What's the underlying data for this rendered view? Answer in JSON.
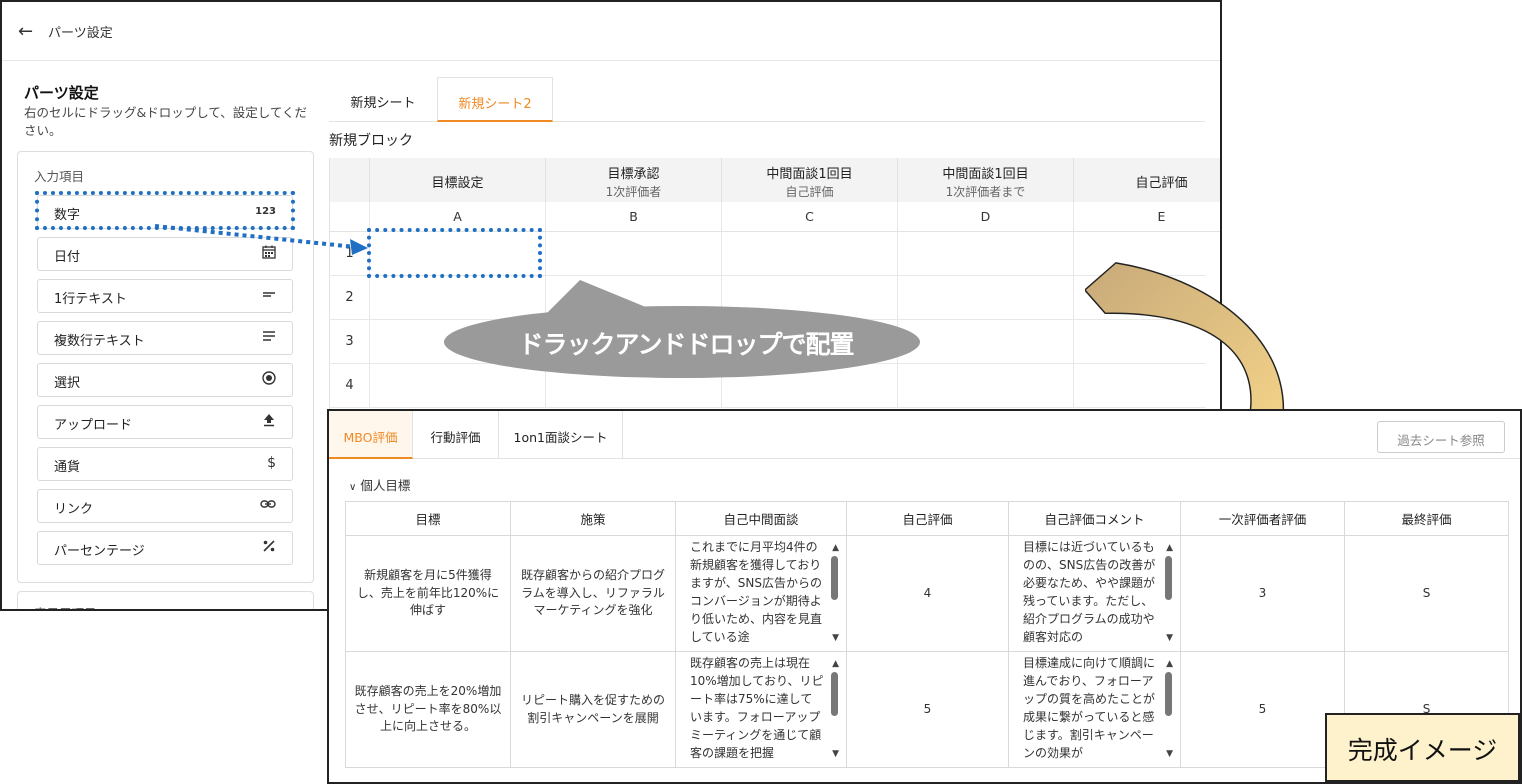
{
  "editor": {
    "topbar_title": "パーツ設定",
    "panel_title": "パーツ設定",
    "panel_desc": "右のセルにドラッグ&ドロップして、設定してください。",
    "parts_section_label": "入力項目",
    "parts_section2_label": "表示用項目",
    "parts": [
      {
        "label": "数字",
        "icon": "123"
      },
      {
        "label": "日付",
        "icon": "calendar-icon"
      },
      {
        "label": "1行テキスト",
        "icon": "short-text-icon"
      },
      {
        "label": "複数行テキスト",
        "icon": "multiline-text-icon"
      },
      {
        "label": "選択",
        "icon": "radio-icon"
      },
      {
        "label": "アップロード",
        "icon": "upload-icon"
      },
      {
        "label": "通貨",
        "icon": "$"
      },
      {
        "label": "リンク",
        "icon": "link-icon"
      },
      {
        "label": "パーセンテージ",
        "icon": "percent-icon"
      }
    ],
    "tabs": [
      "新規シート",
      "新規シート2"
    ],
    "active_tab": "新規シート2",
    "block_title": "新規ブロック",
    "columns": [
      {
        "title": "目標設定",
        "sub": "",
        "letter": "A"
      },
      {
        "title": "目標承認",
        "sub": "1次評価者",
        "letter": "B"
      },
      {
        "title": "中間面談1回目",
        "sub": "自己評価",
        "letter": "C"
      },
      {
        "title": "中間面談1回目",
        "sub": "1次評価者まで",
        "letter": "D"
      },
      {
        "title": "自己評価",
        "sub": "",
        "letter": "E"
      }
    ],
    "row_numbers": [
      "1",
      "2",
      "3",
      "4"
    ],
    "accent": "#f08a24"
  },
  "callout": "ドラックアンドドロップで配置",
  "result": {
    "tabs": [
      "MBO評価",
      "行動評価",
      "1on1面談シート"
    ],
    "active_tab": "MBO評価",
    "past_button": "過去シート参照",
    "section_title": "個人目標",
    "headers": [
      "目標",
      "施策",
      "自己中間面談",
      "自己評価",
      "自己評価コメント",
      "一次評価者評価",
      "最終評価"
    ],
    "rows": [
      {
        "goal": "新規顧客を月に5件獲得し、売上を前年比120%に伸ばす",
        "measure": "既存顧客からの紹介プログラムを導入し、リファラルマーケティングを強化",
        "interview": "これまでに月平均4件の新規顧客を獲得しておりますが、SNS広告からのコンバージョンが期待より低いため、内容を見直している途",
        "self_score": "4",
        "self_comment": "目標には近づいているものの、SNS広告の改善が必要なため、やや課題が残っています。ただし、紹介プログラムの成功や顧客対応の",
        "first_score": "3",
        "final": "S"
      },
      {
        "goal": "既存顧客の売上を20%増加させ、リピート率を80%以上に向上させる。",
        "measure": "リピート購入を促すための割引キャンペーンを展開",
        "interview": "既存顧客の売上は現在10%増加しており、リピート率は75%に達しています。フォローアップミーティングを通じて顧客の課題を把握",
        "self_score": "5",
        "self_comment": "目標達成に向けて順調に進んでおり、フォローアップの質を高めたことが成果に繋がっていると感じます。割引キャンペーンの効果が",
        "first_score": "5",
        "final": "S"
      }
    ]
  },
  "completion_label": "完成イメージ",
  "colors": {
    "highlight_dots": "#1f6fc4",
    "callout_fill": "#9a9a9a",
    "curved_arrow_start": "#c8aa7a",
    "curved_arrow_end": "#fad98a",
    "completion_bg": "#fdf2cc"
  }
}
